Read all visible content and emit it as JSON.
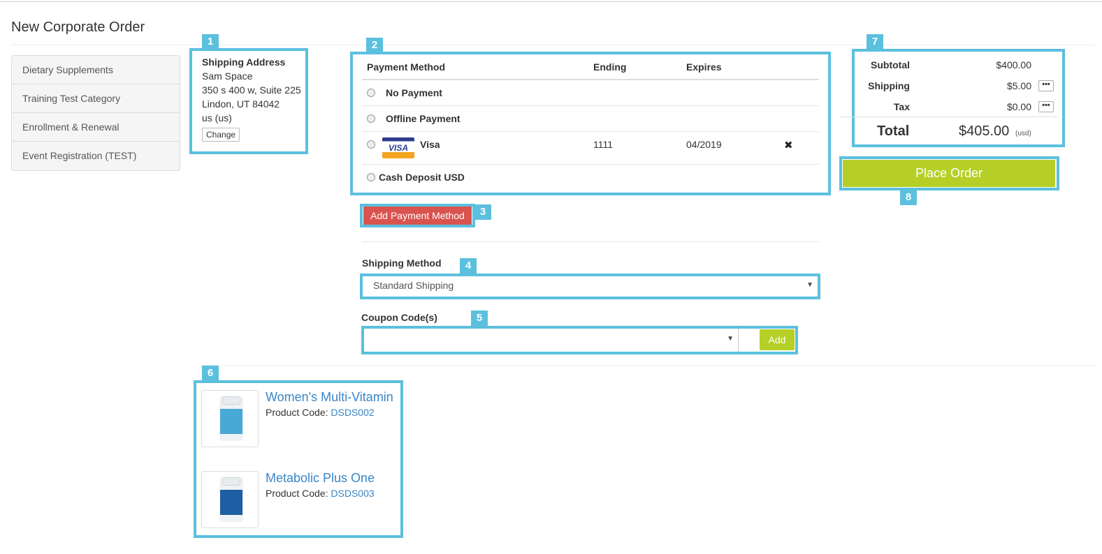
{
  "page": {
    "title": "New Corporate Order"
  },
  "sidebar": {
    "items": [
      {
        "label": "Dietary Supplements"
      },
      {
        "label": "Training Test Category"
      },
      {
        "label": "Enrollment & Renewal"
      },
      {
        "label": "Event Registration (TEST)"
      }
    ]
  },
  "shipping_address": {
    "label": "Shipping Address",
    "name": "Sam Space",
    "line1": "350 s 400 w, Suite 225",
    "line2": "Lindon, UT 84042",
    "country": "us (us)",
    "change_label": "Change"
  },
  "payment": {
    "headers": {
      "method": "Payment Method",
      "ending": "Ending",
      "expires": "Expires"
    },
    "rows": [
      {
        "name": "No Payment",
        "ending": "",
        "expires": ""
      },
      {
        "name": "Offline Payment",
        "ending": "",
        "expires": ""
      },
      {
        "name": "Visa",
        "logo": "VISA",
        "ending": "1111",
        "expires": "04/2019",
        "remove": "✖"
      },
      {
        "name": "Cash Deposit USD",
        "ending": "",
        "expires": ""
      }
    ],
    "add_label": "Add Payment Method"
  },
  "shipping_method": {
    "label": "Shipping Method",
    "selected": "Standard Shipping"
  },
  "coupon": {
    "label": "Coupon Code(s)",
    "selected": "",
    "add_label": "Add"
  },
  "products": [
    {
      "name": "Women's Multi-Vitamin",
      "code_label": "Product Code:",
      "code": "DSDS002",
      "label_color": "#48a9d6"
    },
    {
      "name": "Metabolic Plus One",
      "code_label": "Product Code:",
      "code": "DSDS003",
      "label_color": "#1d5fa3"
    }
  ],
  "totals": {
    "subtotal_label": "Subtotal",
    "subtotal": "$400.00",
    "shipping_label": "Shipping",
    "shipping": "$5.00",
    "tax_label": "Tax",
    "tax": "$0.00",
    "more": "•••",
    "total_label": "Total",
    "total": "$405.00",
    "currency": "(usd)"
  },
  "place_order_label": "Place Order",
  "callouts": [
    "1",
    "2",
    "3",
    "4",
    "5",
    "6",
    "7",
    "8"
  ],
  "colors": {
    "accent": "#5bc0de",
    "danger": "#d9534f",
    "success": "#b5cf26",
    "link": "#3a85c6"
  }
}
